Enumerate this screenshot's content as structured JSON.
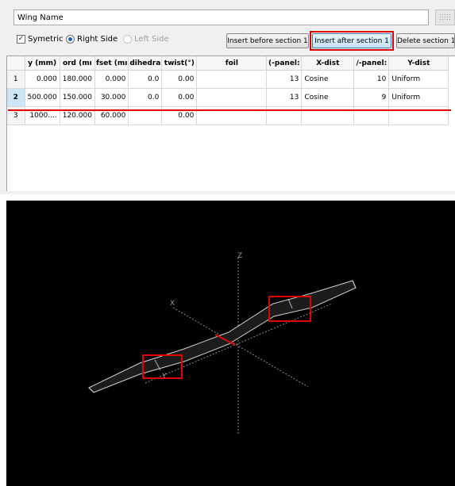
{
  "wing": {
    "name_value": "Wing Name",
    "name_placeholder": ""
  },
  "options": {
    "symetric_label": "Symetric",
    "symetric_checked": true,
    "right_side_label": "Right Side",
    "right_side_selected": true,
    "left_side_label": "Left Side",
    "left_side_enabled": false
  },
  "buttons": {
    "insert_before": "Insert before section 1",
    "insert_after": "Insert after section 1",
    "delete": "Delete section 1"
  },
  "table": {
    "headers": [
      "",
      "y (mm)",
      "ord (mı",
      "fset (mı",
      "dihedra",
      "twist(°)",
      "foil",
      "(-panel:",
      "X-dist",
      "/-panel:",
      "Y-dist"
    ],
    "rows": [
      [
        "1",
        "0.000",
        "180.000",
        "0.000",
        "0.0",
        "0.00",
        "",
        "13",
        "Cosine",
        "10",
        "Uniform"
      ],
      [
        "2",
        "500.000",
        "150.000",
        "30.000",
        "0.0",
        "0.00",
        "",
        "13",
        "Cosine",
        "9",
        "Uniform"
      ],
      [
        "3",
        "1000....",
        "120.000",
        "60.000",
        "",
        "0.00",
        "",
        "",
        "",
        "",
        ""
      ]
    ],
    "selected_row": 1
  },
  "viewport": {
    "axis_labels": {
      "z": "Z",
      "x": "X",
      "y": "Y"
    },
    "background": "#000000",
    "wing_color": "#d0d0d0",
    "highlight_color": "#e00000"
  }
}
